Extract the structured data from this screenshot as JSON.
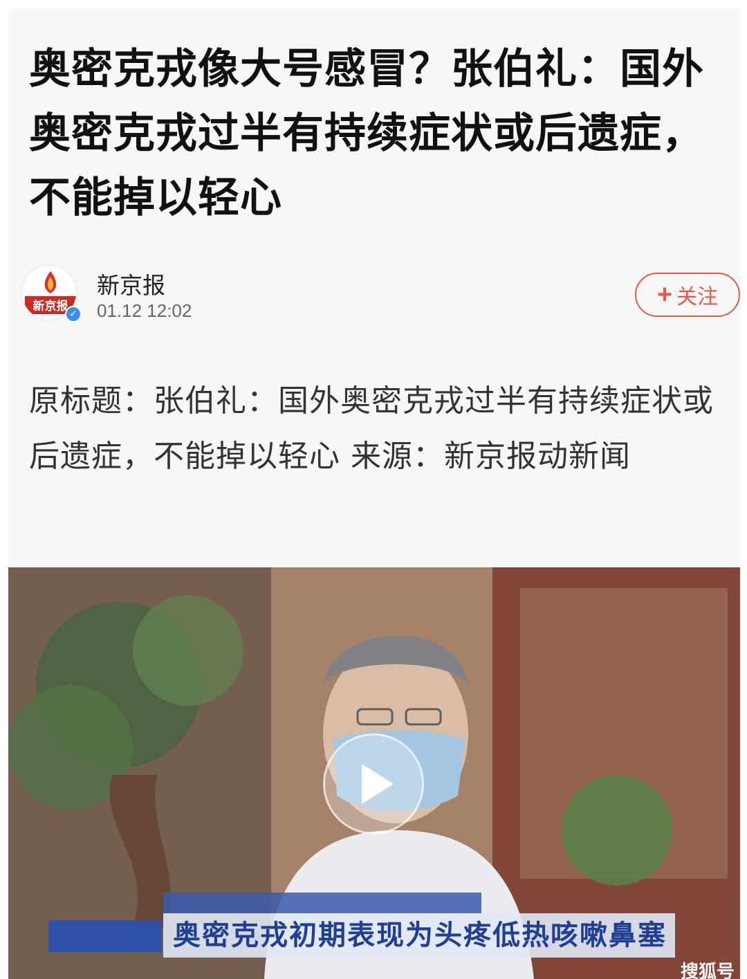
{
  "article": {
    "headline": "奥密克戎像大号感冒？张伯礼：国外奥密克戎过半有持续症状或后遗症，不能掉以轻心",
    "author": {
      "name": "新京报",
      "time": "01.12 12:02",
      "avatar_text": "新京报",
      "follow_label": "关注"
    },
    "body": "原标题：张伯礼：国外奥密克戎过半有持续症状或后遗症，不能掉以轻心 来源：新京报动新闻"
  },
  "video": {
    "caption": "奥密克戎初期表现为头疼低热咳嗽鼻塞",
    "watermark": "搜狐号"
  },
  "colors": {
    "accent": "#e25a45",
    "verified": "#3c8df1",
    "caption_text": "#1f3f94"
  }
}
